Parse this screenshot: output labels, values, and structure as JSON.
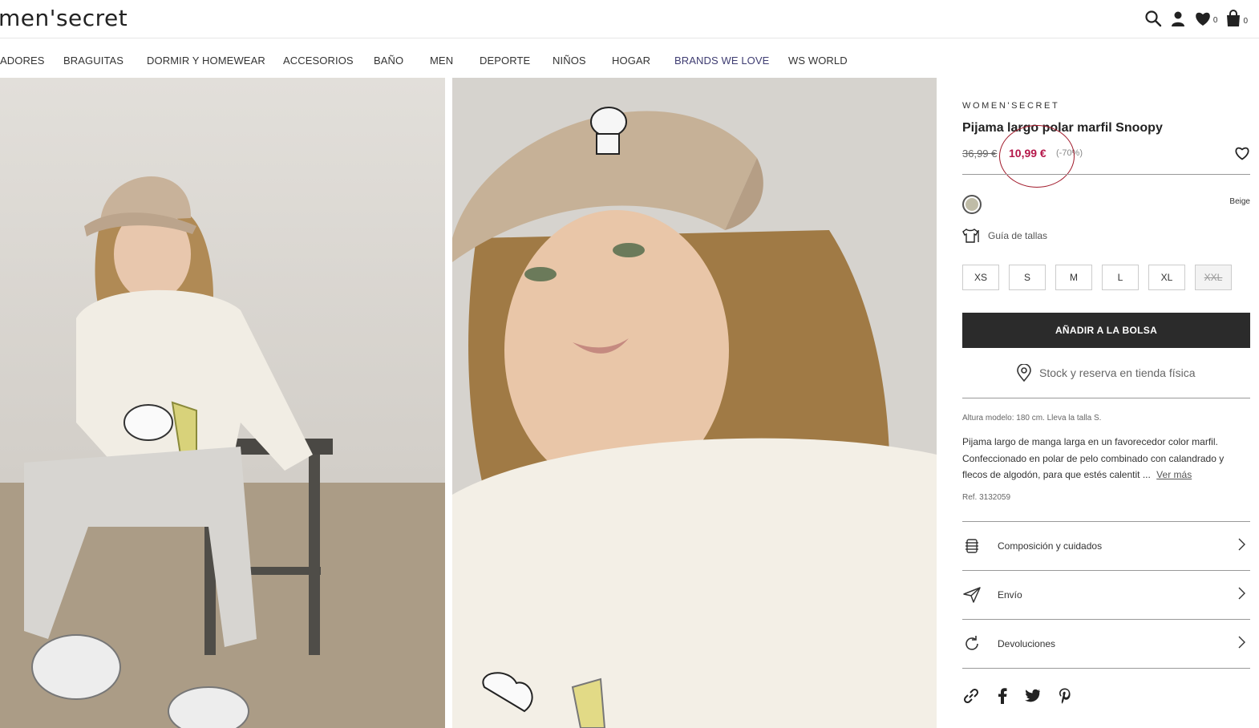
{
  "header": {
    "logo": "men'secret",
    "wishlist_count": "0",
    "bag_count": "0",
    "icons": [
      "search-icon",
      "user-icon",
      "heart-icon",
      "bag-icon"
    ]
  },
  "nav": {
    "items": [
      "ADORES",
      "BRAGUITAS",
      "DORMIR Y HOMEWEAR",
      "ACCESORIOS",
      "BAÑO",
      "MEN",
      "DEPORTE",
      "NIÑOS",
      "HOGAR",
      "BRANDS WE LOVE",
      "WS WORLD"
    ]
  },
  "product": {
    "brand": "WOMEN'SECRET",
    "title": "Pijama largo polar marfil Snoopy",
    "price_old": "36,99 €",
    "price_new": "10,99 €",
    "discount": "(-70%)",
    "color_name": "Beige",
    "color_swatch": "#bfbca7",
    "size_guide": "Guía de tallas",
    "sizes": [
      "XS",
      "S",
      "M",
      "L",
      "XL",
      "XXL"
    ],
    "unavailable_size": "XXL",
    "add_to_bag": "AÑADIR A LA BOLSA",
    "stock_link": "Stock y reserva en tienda física",
    "model_info": "Altura modelo: 180 cm.  Lleva la talla S.",
    "description": "Pijama largo de manga larga en un favorecedor color marfil. Confeccionado en polar de pelo combinado con calandrado y flecos de algodón, para que estés calentit ...",
    "see_more": "Ver más",
    "ref": "Ref. 3132059",
    "accordion": [
      "Composición y cuidados",
      "Envío",
      "Devoluciones"
    ]
  },
  "colors": {
    "sale_price": "#b5174a",
    "button_bg": "#2b2b2b",
    "nav_highlight": "#3f3d72"
  }
}
